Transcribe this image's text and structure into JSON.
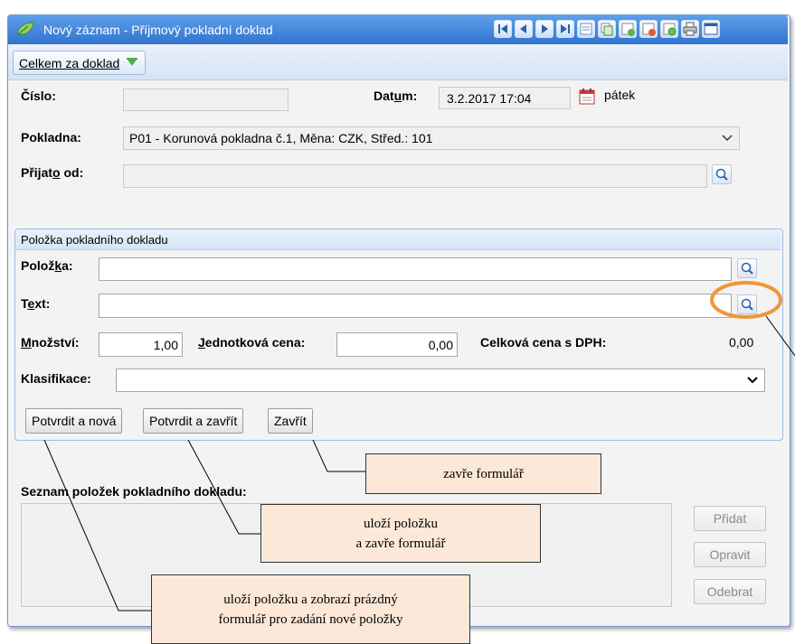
{
  "window": {
    "title": "Nový záznam - Příjmový pokladní doklad"
  },
  "toolbar": {
    "total_button": "Celkem za doklad"
  },
  "header": {
    "cislo_label": "Číslo:",
    "cislo_value": "",
    "datum_label_pre": "Dat",
    "datum_label_u": "u",
    "datum_label_post": "m:",
    "datum_value": "3.2.2017 17:04",
    "day_name": "pátek",
    "pokladna_label": "Pokladna:",
    "pokladna_value": "P01 - Korunová pokladna č.1, Měna: CZK, Střed.: 101",
    "prijato_label_pre": "Přijat",
    "prijato_label_u": "o",
    "prijato_label_post": " od:",
    "prijato_value": ""
  },
  "item_group": {
    "title": "Položka pokladního dokladu",
    "polozka_label_pre": "Polož",
    "polozka_label_u": "k",
    "polozka_label_post": "a:",
    "polozka_value": "",
    "text_label_pre": "T",
    "text_label_u": "e",
    "text_label_post": "xt:",
    "text_value": "",
    "mnozstvi_label_u": "M",
    "mnozstvi_label_post": "nožství:",
    "mnozstvi_value": "1,00",
    "jedn_cena_label_u": "J",
    "jedn_cena_label_post": "ednotková cena:",
    "jedn_cena_value": "0,00",
    "celkova_cena_label": "Celková cena s DPH:",
    "celkova_cena_value": "0,00",
    "klasifikace_label": "Klasifikace:",
    "klasifikace_value": "",
    "confirm_new_button": "Potvrdit a nová",
    "confirm_close_button": "Potvrdit a zavřít",
    "close_button": "Zavřít"
  },
  "list": {
    "title": "Seznam položek pokladního dokladu:",
    "add_button": "Přidat",
    "edit_button": "Opravit",
    "remove_button": "Odebrat"
  },
  "callouts": {
    "close_form": "zavře formulář",
    "save_close_line1": "uloží položku",
    "save_close_line2": "a zavře formulář",
    "save_new_line1": "uloží položku a zobrazí prázdný",
    "save_new_line2": "formulář pro zadání nové položky"
  },
  "colors": {
    "titlebar": "#3a7fd8",
    "callout_fill": "#fce8d8",
    "highlight_ring": "#f0963a"
  }
}
